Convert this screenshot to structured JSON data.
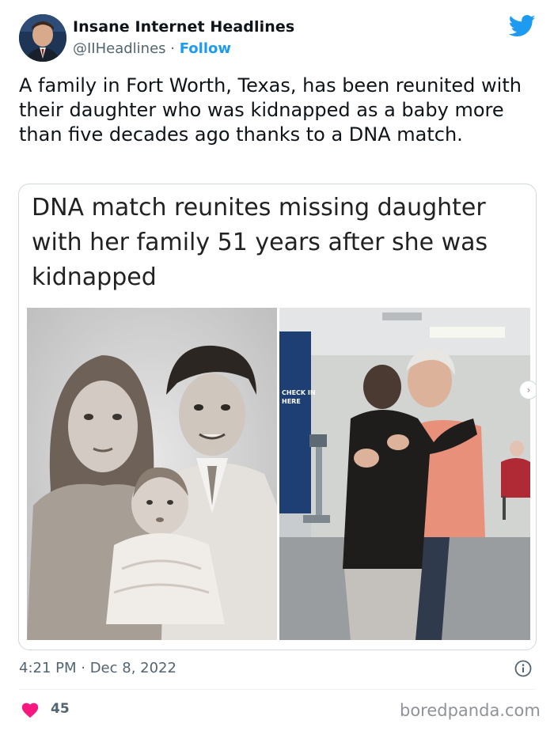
{
  "author": {
    "name": "Insane Internet Headlines",
    "handle": "@IIHeadlines",
    "separator": " · ",
    "follow_label": "Follow"
  },
  "tweet": {
    "text": "A family in Fort Worth, Texas, has been reunited with their daughter who was kidnapped as a baby more than five decades ago thanks to a DNA match."
  },
  "card": {
    "headline": "DNA match reunites missing daughter with her family 51 years after she was kidnapped",
    "right_photo_sign": "CHECK IN HERE"
  },
  "meta": {
    "timestamp": "4:21 PM · Dec 8, 2022",
    "likes": "45"
  },
  "watermark": "boredpanda.com",
  "icons": {
    "brand": "twitter-bird-icon",
    "info": "info-icon",
    "like": "heart-icon",
    "carousel": "chevron-right-icon"
  },
  "colors": {
    "accent": "#1d9bf0",
    "like": "#f91880",
    "text": "#0f1419",
    "muted": "#536471"
  }
}
